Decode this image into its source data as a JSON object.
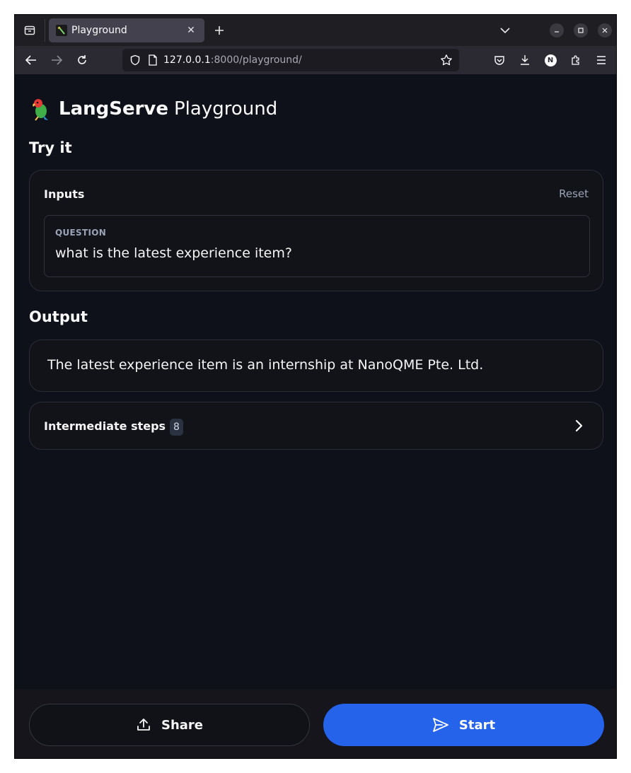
{
  "browser": {
    "tab_title": "Playground",
    "url_host": "127.0.0.1",
    "url_rest": ":8000/playground/",
    "profile_initial": "N"
  },
  "page": {
    "brand_bold": "LangServe",
    "brand_rest": "Playground",
    "try_it": "Try it",
    "inputs": {
      "label": "Inputs",
      "reset": "Reset",
      "question_label": "QUESTION",
      "question_value": "what is the latest experience item?"
    },
    "output": {
      "heading": "Output",
      "text": "The latest experience item is an internship at NanoQME Pte. Ltd."
    },
    "intermediate": {
      "label": "Intermediate steps",
      "count": "8"
    }
  },
  "footer": {
    "share_label": "Share",
    "start_label": "Start"
  },
  "colors": {
    "accent": "#2563eb",
    "page_bg": "#0e111a",
    "card_border": "#2a2d35"
  }
}
